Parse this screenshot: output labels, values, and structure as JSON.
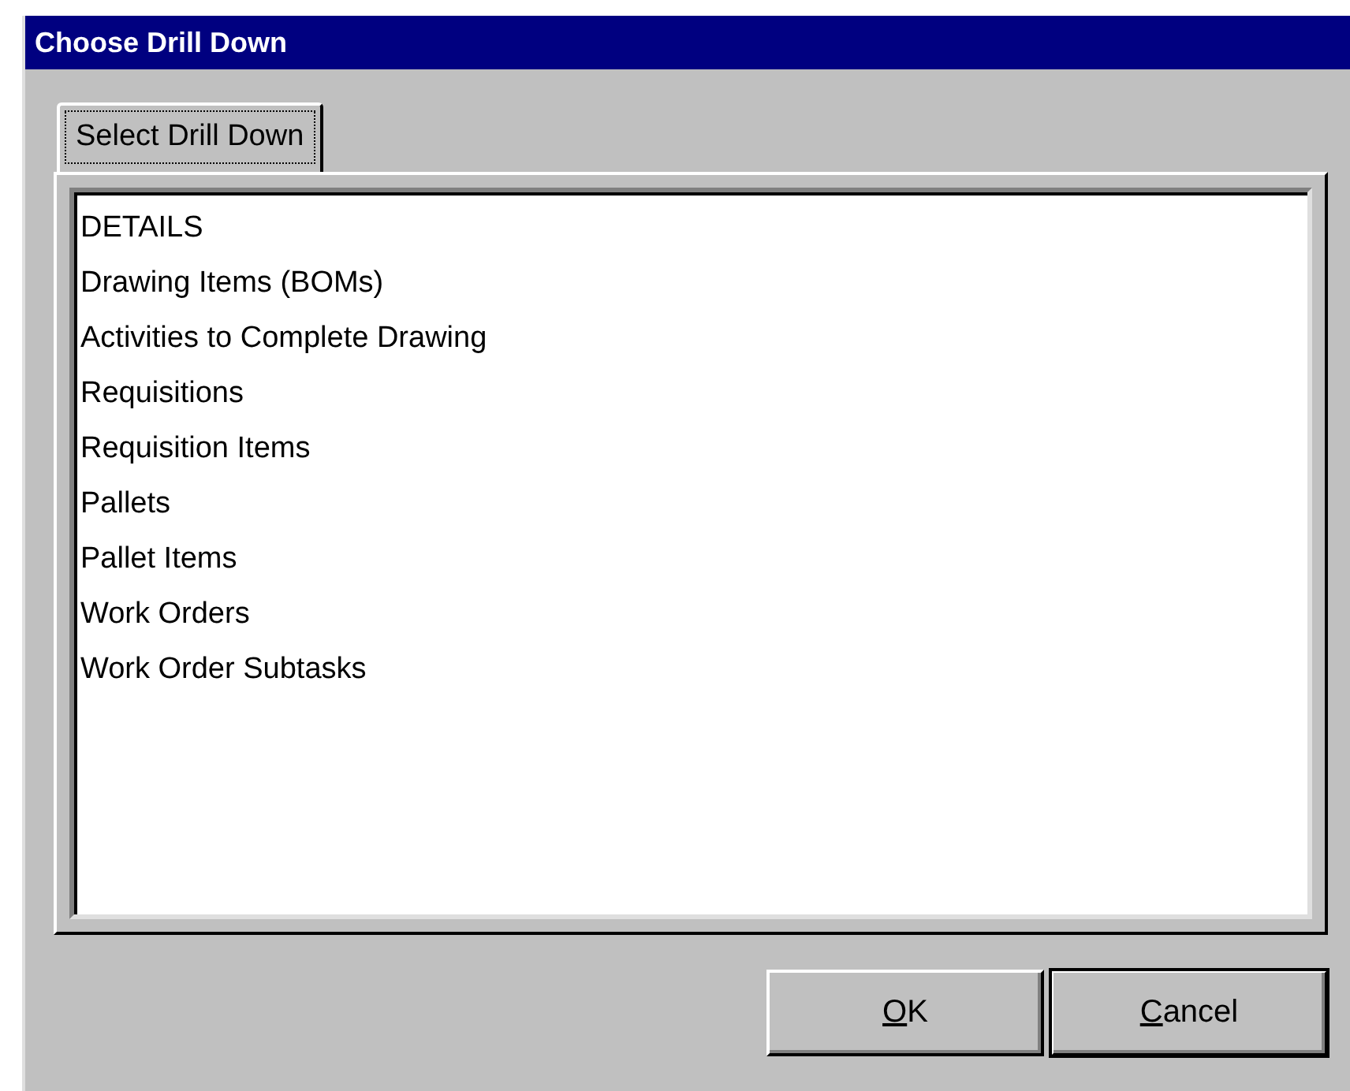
{
  "window": {
    "title": "Choose Drill Down"
  },
  "tabs": [
    {
      "label": "Select Drill Down",
      "selected": true,
      "focused": true
    }
  ],
  "list": {
    "items": [
      {
        "label": "DETAILS",
        "selected": false
      },
      {
        "label": "Drawing Items (BOMs)",
        "selected": false
      },
      {
        "label": "Activities to Complete Drawing",
        "selected": false
      },
      {
        "label": "Requisitions",
        "selected": false
      },
      {
        "label": "Requisition Items",
        "selected": false
      },
      {
        "label": "Pallets",
        "selected": false
      },
      {
        "label": "Pallet Items",
        "selected": false
      },
      {
        "label": "Work Orders",
        "selected": false
      },
      {
        "label": "Work Order Subtasks",
        "selected": false
      }
    ]
  },
  "buttons": [
    {
      "mnemonic": "O",
      "rest": "K",
      "default": false
    },
    {
      "mnemonic": "C",
      "rest": "ancel",
      "default": true
    }
  ]
}
